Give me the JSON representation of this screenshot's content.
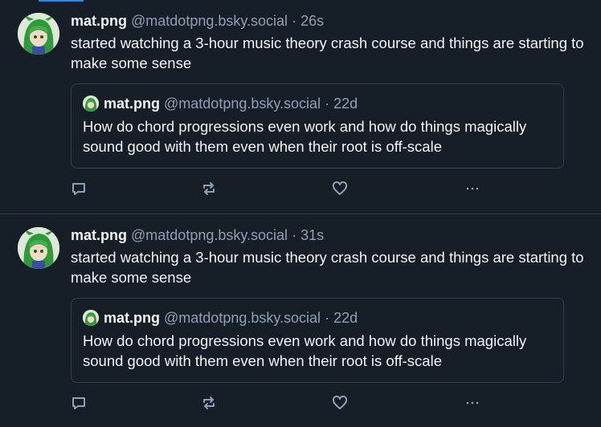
{
  "posts": [
    {
      "author": {
        "name": "mat.png",
        "handle": "@matdotpng.bsky.social",
        "avatar_icon": "avatar-anime-green-hair"
      },
      "time": "26s",
      "text": "started watching a 3-hour music theory crash course and things are starting to make some sense",
      "quote": {
        "author": {
          "name": "mat.png",
          "handle": "@matdotpng.bsky.social"
        },
        "time": "22d",
        "text": "How do chord progressions even work and how do things magically sound good with them even when their root is off-scale"
      },
      "actions": {
        "reply_icon": "reply-icon",
        "repost_icon": "repost-icon",
        "like_icon": "like-icon",
        "more_icon": "more-icon"
      }
    },
    {
      "author": {
        "name": "mat.png",
        "handle": "@matdotpng.bsky.social",
        "avatar_icon": "avatar-anime-green-hair"
      },
      "time": "31s",
      "text": "started watching a 3-hour music theory crash course and things are starting to make some sense",
      "quote": {
        "author": {
          "name": "mat.png",
          "handle": "@matdotpng.bsky.social"
        },
        "time": "22d",
        "text": "How do chord progressions even work and how do things magically sound good with them even when their root is off-scale"
      },
      "actions": {
        "reply_icon": "reply-icon",
        "repost_icon": "repost-icon",
        "like_icon": "like-icon",
        "more_icon": "more-icon"
      }
    }
  ],
  "colors": {
    "background": "#161e27",
    "border": "#2e4052",
    "muted": "#8ea0b5",
    "text": "#f1f3f5",
    "accent": "#208bfe"
  }
}
